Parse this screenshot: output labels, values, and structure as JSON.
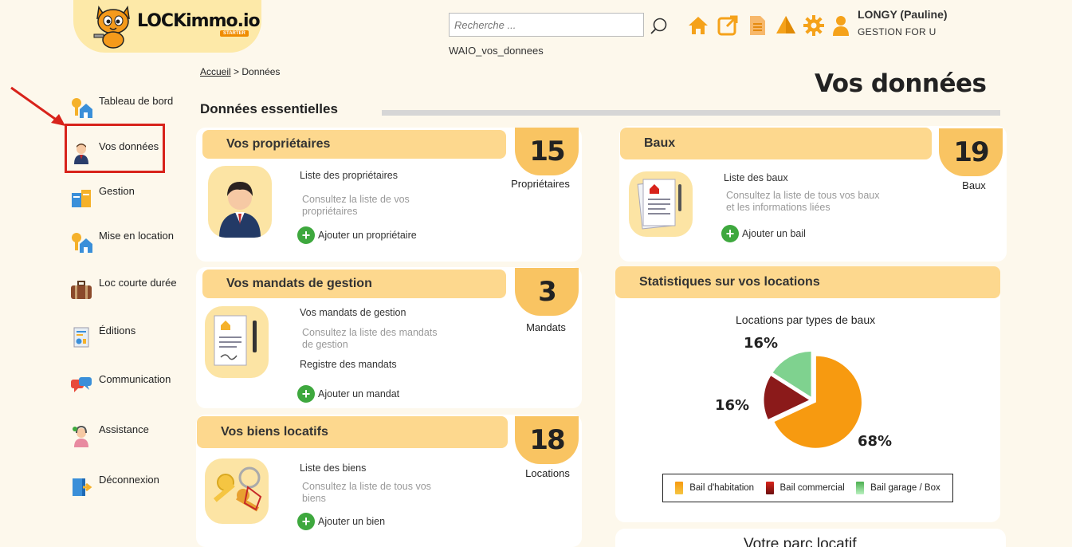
{
  "header": {
    "logo": "LOCKimmo.io",
    "logo_badge": "STARTER",
    "search_placeholder": "Recherche ...",
    "subtext": "WAIO_vos_donnees",
    "user_name": "LONGY (Pauline)",
    "user_org": "GESTION FOR U",
    "icons": [
      "home-icon",
      "external-link-icon",
      "document-icon",
      "alert-icon",
      "gear-icon",
      "user-icon"
    ]
  },
  "sidebar": {
    "items": [
      {
        "label": "Tableau de bord",
        "icon": "dashboard-key-house-icon"
      },
      {
        "label": "Vos données",
        "icon": "person-icon"
      },
      {
        "label": "Gestion",
        "icon": "management-icon"
      },
      {
        "label": "Mise en location",
        "icon": "rental-key-house-icon"
      },
      {
        "label": "Loc courte durée",
        "icon": "suitcase-icon"
      },
      {
        "label": "Éditions",
        "icon": "report-icon"
      },
      {
        "label": "Communication",
        "icon": "chat-bubbles-icon"
      },
      {
        "label": "Assistance",
        "icon": "support-agent-icon"
      },
      {
        "label": "Déconnexion",
        "icon": "logout-icon"
      }
    ],
    "active": "Vos données"
  },
  "breadcrumb": {
    "home": "Accueil",
    "sep": ">",
    "current": "Données"
  },
  "page_title": "Vos données",
  "section_title": "Données essentielles",
  "cards": {
    "proprietaires": {
      "title": "Vos propriétaires",
      "count": "15",
      "count_label": "Propriétaires",
      "link": "Liste des propriétaires",
      "desc": "Consultez la liste de vos propriétaires",
      "add": "Ajouter un propriétaire"
    },
    "baux": {
      "title": "Baux",
      "count": "19",
      "count_label": "Baux",
      "link": "Liste des baux",
      "desc": "Consultez la liste de tous vos baux et les informations liées",
      "add": "Ajouter un bail"
    },
    "mandats": {
      "title": "Vos mandats de gestion",
      "count": "3",
      "count_label": "Mandats",
      "link": "Vos mandats de gestion",
      "desc": "Consultez la liste des mandats de gestion",
      "link2": "Registre des mandats",
      "add": "Ajouter un mandat"
    },
    "biens": {
      "title": "Vos biens locatifs",
      "count": "18",
      "count_label": "Locations",
      "link": "Liste des biens",
      "desc": "Consultez la liste de tous vos biens",
      "add": "Ajouter un bien"
    },
    "stats": {
      "title": "Statistiques sur vos locations",
      "chart_title": "Locations par types de baux"
    },
    "parc": {
      "title": "Votre parc locatif"
    }
  },
  "chart_data": {
    "type": "pie",
    "title": "Locations par types de baux",
    "series": [
      {
        "name": "Bail d'habitation",
        "value": 68,
        "color": "#f79a10"
      },
      {
        "name": "Bail commercial",
        "value": 16,
        "color": "#8b1a1a"
      },
      {
        "name": "Bail garage / Box",
        "value": 16,
        "color": "#7fd28f"
      }
    ],
    "labels": [
      "68%",
      "16%",
      "16%"
    ],
    "legend": "bottom"
  }
}
